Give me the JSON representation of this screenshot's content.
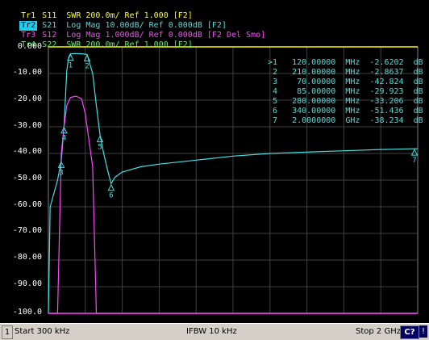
{
  "traces": [
    {
      "label": "Tr1",
      "text": " S11  SWR 200.0m/ Ref 1.000 [F2]",
      "color": "#ffff00",
      "active": false
    },
    {
      "label": "Tr2",
      "text": " S21  Log Mag 10.00dB/ Ref 0.000dB [F2]",
      "color": "#44e0e0",
      "active": true
    },
    {
      "label": "Tr3",
      "text": " S12  Log Mag 1.000dB/ Ref 0.000dB [F2 Del Smo]",
      "color": "#ff44ff",
      "active": false
    },
    {
      "label": "Tr4",
      "text": " S22  SWR 200.0m/ Ref 1.000 [F2]",
      "color": "#44ff44",
      "active": false
    }
  ],
  "y_ticks": [
    "0.000",
    "-10.00",
    "-20.00",
    "-30.00",
    "-40.00",
    "-50.00",
    "-60.00",
    "-70.00",
    "-80.00",
    "-90.00",
    "-100.0"
  ],
  "markers_table": [
    ">1   120.00000  MHz  -2.6202  dB",
    " 2   210.00000  MHz  -2.8637  dB",
    " 3    70.00000  MHz  -42.824  dB",
    " 4    85.00000  MHz  -29.923  dB",
    " 5   280.00000  MHz  -33.206  dB",
    " 6   340.00000  MHz  -51.436  dB",
    " 7   2.0000000  GHz  -38.234  dB"
  ],
  "status": {
    "channel": "1",
    "start": "Start 300 kHz",
    "ifbw": "IFBW 10 kHz",
    "stop": "Stop 2 GHz",
    "cal": "C?",
    "flag": "!"
  },
  "colors": {
    "s11": "#ffff00",
    "s21": "#44e0e0",
    "s12": "#ff44ff",
    "s22": "#44ff44",
    "grid": "#404040",
    "ref_line": "#ffff00"
  },
  "chart_data": {
    "type": "line",
    "title": "",
    "xlabel": "",
    "ylabel": "",
    "x_unit": "MHz",
    "xlim": [
      0.3,
      2000
    ],
    "ylim": [
      -100,
      0
    ],
    "grid": true,
    "series": [
      {
        "name": "S21",
        "color": "#44e0e0",
        "x": [
          0.3,
          10,
          30,
          50,
          70,
          85,
          100,
          110,
          120,
          150,
          180,
          210,
          240,
          260,
          280,
          300,
          320,
          340,
          360,
          400,
          500,
          600,
          800,
          1000,
          1200,
          1400,
          1600,
          1800,
          2000
        ],
        "y": [
          -100,
          -60,
          -55,
          -50,
          -42.8,
          -29.9,
          -9,
          -4,
          -2.6,
          -2.5,
          -2.6,
          -2.86,
          -10,
          -22,
          -33.2,
          -40,
          -46,
          -51.4,
          -49,
          -47,
          -45,
          -44,
          -42.5,
          -41,
          -40,
          -39.5,
          -39,
          -38.5,
          -38.2
        ]
      },
      {
        "name": "S12",
        "color": "#ff44ff",
        "x": [
          0.3,
          50,
          70,
          85,
          100,
          120,
          150,
          180,
          200,
          220,
          240,
          260,
          280,
          2000
        ],
        "y": [
          -100,
          -100,
          -40,
          -30,
          -22,
          -19,
          -18.5,
          -19.5,
          -25,
          -35,
          -45,
          -100,
          -100,
          -100
        ]
      }
    ],
    "markers": [
      {
        "id": "1",
        "x": 120,
        "y": -2.6202
      },
      {
        "id": "2",
        "x": 210,
        "y": -2.8637
      },
      {
        "id": "3",
        "x": 70,
        "y": -42.824
      },
      {
        "id": "4",
        "x": 85,
        "y": -29.923
      },
      {
        "id": "5",
        "x": 280,
        "y": -33.206
      },
      {
        "id": "6",
        "x": 340,
        "y": -51.436
      },
      {
        "id": "7",
        "x": 2000,
        "y": -38.234
      }
    ]
  }
}
